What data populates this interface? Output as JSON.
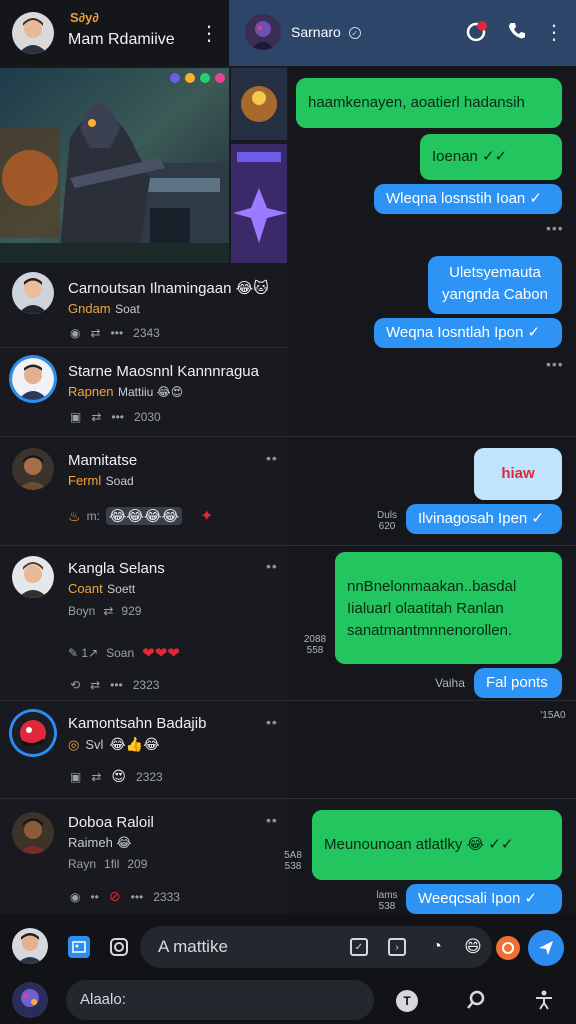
{
  "header": {
    "title_top": "Ѕ∂y∂",
    "title": "Mam Rdamiive",
    "contact_name": "Sarnaro",
    "contact_badge": "✓"
  },
  "left_chats": [
    {
      "name": "Carnoutsan Ilnamingaan 😂🐱",
      "sub": "Gndam",
      "sub2": "Soat",
      "meta": "2343"
    },
    {
      "name": "Starne Maosnnl Kannnragua",
      "sub": "Rapnen",
      "sub2": "Mattiiu 😂😍",
      "meta": "2030"
    },
    {
      "name": "Mamitatse",
      "sub": "Ferml",
      "sub2": "Soad",
      "meta": "m:",
      "emoji": "😂😂😂😂"
    },
    {
      "name": "Kangla Selans",
      "sub": "Coant",
      "sub2": "Soett",
      "meta": "Boyn",
      "meta2": "929",
      "extra": "Soan",
      "meta3": "2323"
    },
    {
      "name": "Kamontsahn Badajib",
      "sub": "Svl",
      "sub2": "😂👍😂",
      "meta": "2323"
    },
    {
      "name": "Doboa Raloil",
      "sub": "Raimeh 😂",
      "sub2": "",
      "meta": "Rayn",
      "meta2": "1fil",
      "meta3": "209",
      "meta4": "2333"
    }
  ],
  "messages": [
    {
      "text": "haamkenayen, aoatierl hadansih",
      "type": "green"
    },
    {
      "text": "Ioenan ✓✓",
      "type": "green"
    },
    {
      "text": "Wleqna losnstih Ioan ✓",
      "type": "blue"
    },
    {
      "text": "Uletsyemauta",
      "text2": "yangnda Cabon",
      "type": "blue"
    },
    {
      "text": "Weqna Iosntlah Ipon ✓",
      "type": "blue"
    },
    {
      "text": "hiaw",
      "type": "light"
    },
    {
      "text": "Ilvinagosah Ipen ✓",
      "type": "blue"
    },
    {
      "text": "nnBnelonmaakan..basdal",
      "text2": "Iialuarl olaatitah Ranlan",
      "text3": "sanatmantmnnenorollen.",
      "type": "green"
    },
    {
      "text": "Fal ponts",
      "type": "blue"
    },
    {
      "text": "Meunounoan atlatlky 😂 ✓✓",
      "type": "green"
    },
    {
      "text": "Weeqcsali Ipon ✓",
      "type": "blue"
    }
  ],
  "time_labels": {
    "t1": "Duls",
    "t1b": "620",
    "t2": "2088",
    "t2b": "558",
    "t3": "Vaiha",
    "t4": "5A8",
    "t4b": "538",
    "t5": "lams",
    "t5b": "538",
    "t6": "'15A0"
  },
  "composer": {
    "placeholder": "A mattike",
    "search_placeholder": "Alaalo:"
  },
  "colors": {
    "accent": "#2d8cf0",
    "green": "#22c55e",
    "header": "#2c4569"
  }
}
